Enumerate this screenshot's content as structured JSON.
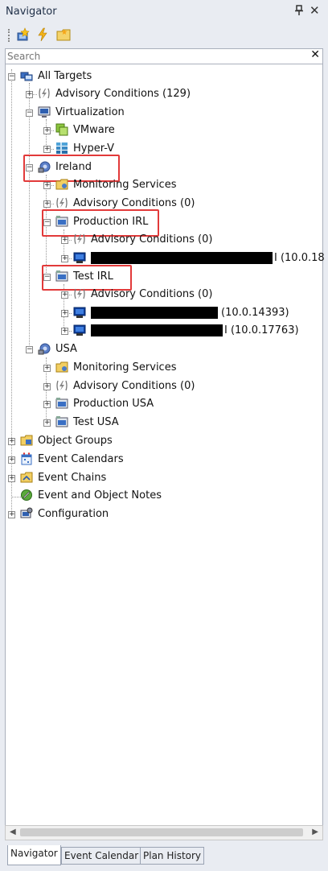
{
  "window": {
    "title": "Navigator"
  },
  "search": {
    "placeholder": "Search"
  },
  "tree": {
    "all_targets": "All Targets",
    "advisory_129": "Advisory Conditions (129)",
    "virtualization": "Virtualization",
    "vmware": "VMware",
    "hyperv": "Hyper-V",
    "ireland": "Ireland",
    "monitoring_services_irl": "Monitoring Services",
    "advisory_irl": "Advisory Conditions (0)",
    "production_irl": "Production IRL",
    "advisory_prod_irl": "Advisory Conditions (0)",
    "server_prod_irl_suffix": "I (10.0.18",
    "test_irl": "Test IRL",
    "advisory_test_irl": "Advisory Conditions (0)",
    "server_test1_suffix": "(10.0.14393)",
    "server_test2_suffix": "I (10.0.17763)",
    "usa": "USA",
    "monitoring_services_usa": "Monitoring Services",
    "advisory_usa": "Advisory Conditions (0)",
    "production_usa": "Production USA",
    "test_usa": "Test USA",
    "object_groups": "Object Groups",
    "event_calendars": "Event Calendars",
    "event_chains": "Event Chains",
    "event_object_notes": "Event and Object Notes",
    "configuration": "Configuration"
  },
  "tabs": [
    "Navigator",
    "Event Calendar",
    "Plan History"
  ],
  "colors": {
    "highlight": "#e23a3a",
    "panel_bg": "#e9ecf2"
  }
}
